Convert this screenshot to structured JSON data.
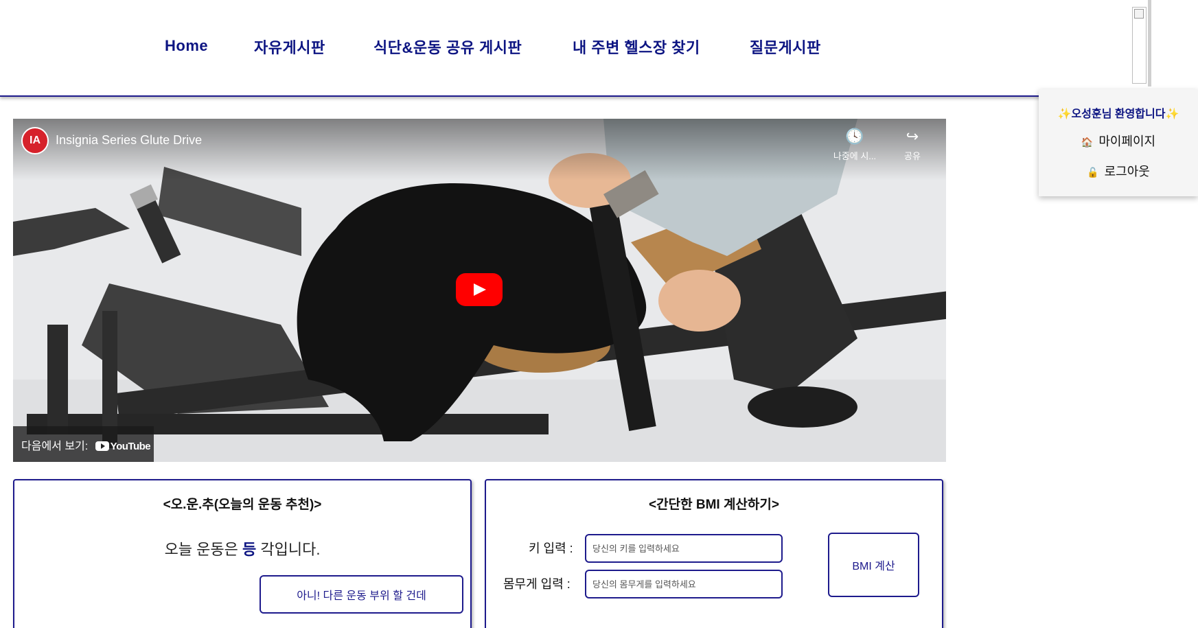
{
  "nav": {
    "items": [
      {
        "label": "Home"
      },
      {
        "label": "자유게시판"
      },
      {
        "label": "식단&운동 공유 게시판"
      },
      {
        "label": "내 주변 헬스장 찾기"
      },
      {
        "label": "질문게시판"
      }
    ]
  },
  "user_menu": {
    "welcome": "오성훈님 환영합니다",
    "mypage": "마이페이지",
    "logout": "로그아웃"
  },
  "video": {
    "channel_logo": "IA",
    "title": "Insignia Series Glute Drive",
    "watch_later": "나중에 시...",
    "share": "공유",
    "watch_on": "다음에서 보기:",
    "youtube": "YouTube"
  },
  "workout_card": {
    "title": "<오.운.추(오늘의 운동 추천)>",
    "text_before": "오늘 운동은 ",
    "body_part": "등",
    "text_after": " 각입니다.",
    "change_button": "아니! 다른 운동 부위 할 건데"
  },
  "bmi_card": {
    "title": "<간단한 BMI 계산하기>",
    "height_label": "키 입력 :",
    "height_placeholder": "당신의 키를 입력하세요",
    "weight_label": "몸무게 입력 :",
    "weight_placeholder": "당신의 몸무게를 입력하세요",
    "calc_button": "BMI 계산"
  },
  "colors": {
    "accent": "#0c1482",
    "border": "#1d1a8c",
    "youtube_red": "#ff0000"
  }
}
